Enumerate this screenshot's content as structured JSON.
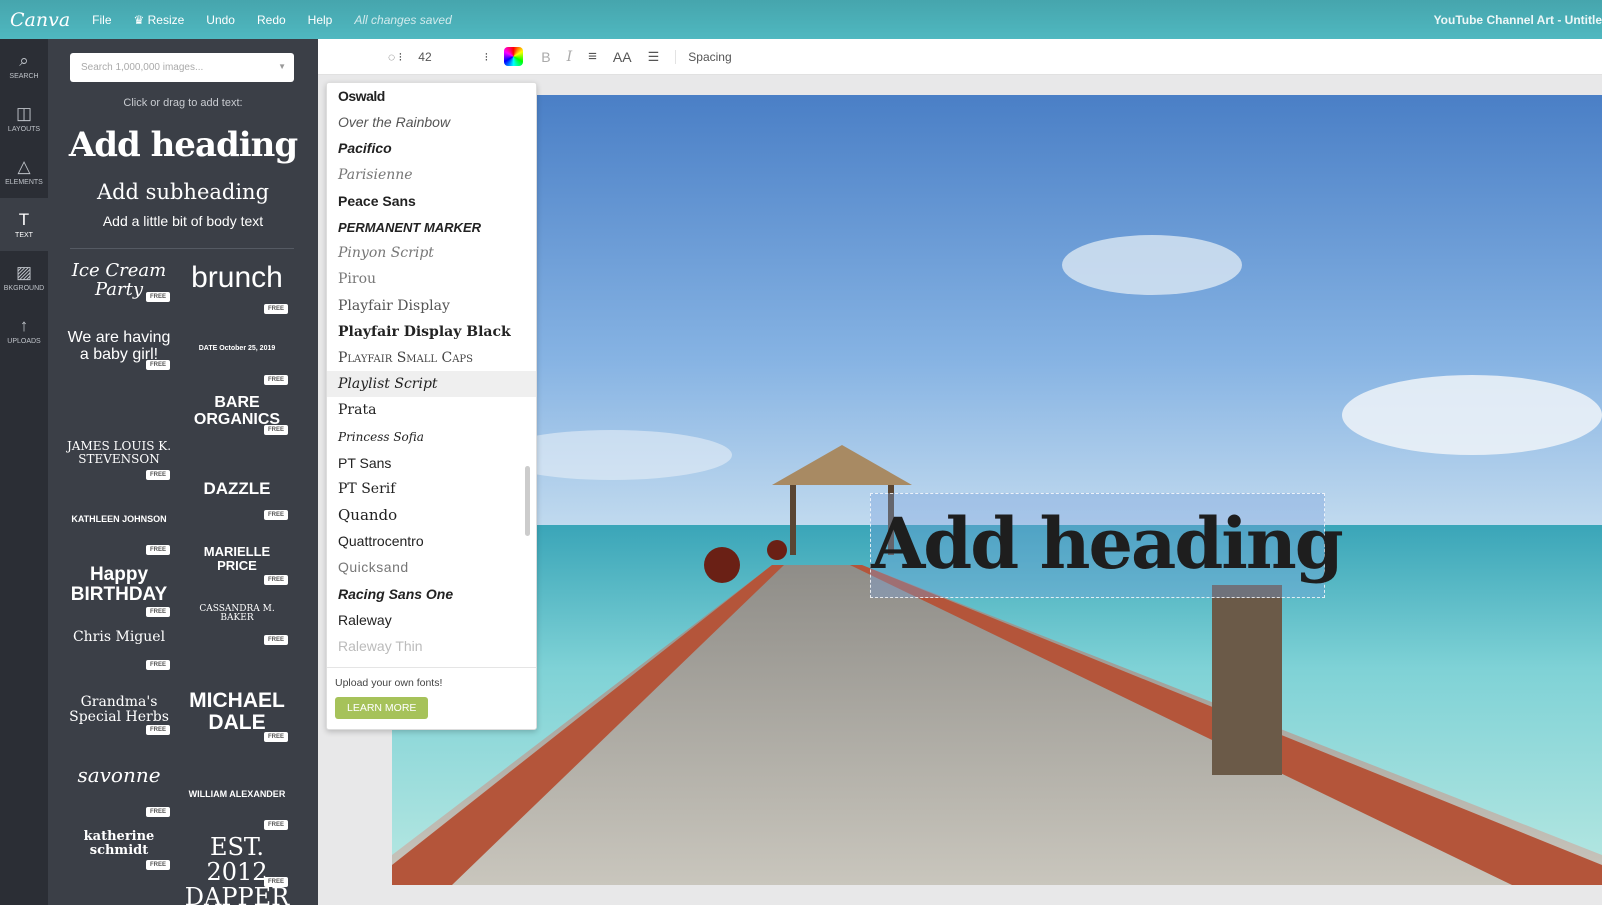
{
  "topbar": {
    "logo": "Canva",
    "menu": [
      "File",
      "♛ Resize",
      "Undo",
      "Redo",
      "Help"
    ],
    "status": "All changes saved",
    "doc_title": "YouTube Channel Art - Untitle"
  },
  "rail": [
    {
      "icon": "search-icon",
      "glyph": "⌕",
      "label": "SEARCH"
    },
    {
      "icon": "layouts-icon",
      "glyph": "◫",
      "label": "LAYOUTS"
    },
    {
      "icon": "elements-icon",
      "glyph": "△",
      "label": "ELEMENTS"
    },
    {
      "icon": "text-icon",
      "glyph": "T",
      "label": "TEXT"
    },
    {
      "icon": "background-icon",
      "glyph": "▨",
      "label": "BKGROUND"
    },
    {
      "icon": "upload-icon",
      "glyph": "↑",
      "label": "UPLOADS"
    }
  ],
  "panel": {
    "search_placeholder": "Search 1,000,000 images...",
    "hint": "Click or drag to add text:",
    "heading": "Add heading",
    "subheading": "Add subheading",
    "body": "Add a little bit of body text",
    "free": "FREE",
    "templates_left": [
      "Ice Cream Party",
      "We are having a baby girl!",
      "JAMES LOUIS K. STEVENSON",
      "KATHLEEN JOHNSON",
      "Happy BIRTHDAY",
      "Chris Miguel",
      "Grandma's Special Herbs",
      "savonne",
      "katherine schmidt"
    ],
    "templates_right": [
      "brunch",
      "DATE  October 25, 2019",
      "BARE ORGANICS",
      "DAZZLE",
      "MARIELLE PRICE",
      "CASSANDRA M. BAKER",
      "MICHAEL DALE",
      "WILLIAM ALEXANDER",
      "EST. 2012 DAPPER"
    ]
  },
  "toolbar": {
    "font_size": "42",
    "bold": "B",
    "italic": "I",
    "align": "≡",
    "case": "AA",
    "list": "☰",
    "spacing": "Spacing"
  },
  "font_dropdown": {
    "fonts": [
      "Oswald",
      "Over the Rainbow",
      "Pacifico",
      "Parisienne",
      "Peace Sans",
      "Permanent Marker",
      "Pinyon Script",
      "Pirou",
      "Playfair Display",
      "Playfair Display Black",
      "Playfair Small Caps",
      "Playlist Script",
      "Prata",
      "Princess Sofia",
      "PT Sans",
      "PT Serif",
      "Quando",
      "Quattrocentro",
      "Quicksand",
      "Racing Sans One",
      "Raleway",
      "Raleway Thin"
    ],
    "selected": "Playlist Script",
    "upload_text": "Upload your own fonts!",
    "learn_more": "LEARN MORE"
  },
  "canvas": {
    "heading_text": "Add heading"
  },
  "colors": {
    "topbar": "#4fb8c0",
    "panel": "#3b3f47",
    "rail": "#2b2e35",
    "learn_more": "#a6c25a"
  }
}
